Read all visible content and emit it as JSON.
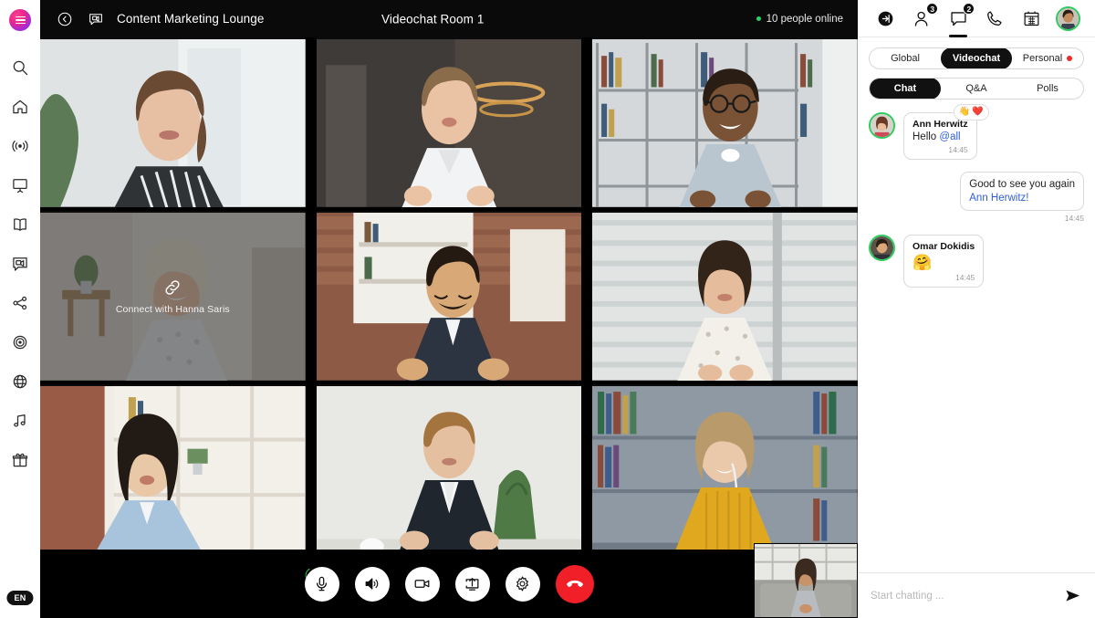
{
  "app": {
    "logo": "hamburger-logo",
    "language_badge": "EN"
  },
  "left_rail": {
    "items": [
      {
        "icon": "search-icon",
        "name": "search"
      },
      {
        "icon": "home-icon",
        "name": "home"
      },
      {
        "icon": "broadcast-icon",
        "name": "broadcast"
      },
      {
        "icon": "presentation-icon",
        "name": "presentation"
      },
      {
        "icon": "book-icon",
        "name": "library"
      },
      {
        "icon": "videochat-icon",
        "name": "videochat"
      },
      {
        "icon": "share-network-icon",
        "name": "network"
      },
      {
        "icon": "target-icon",
        "name": "goals"
      },
      {
        "icon": "globe-icon",
        "name": "globe"
      },
      {
        "icon": "music-icon",
        "name": "music"
      },
      {
        "icon": "gift-icon",
        "name": "gifts"
      }
    ]
  },
  "topbar": {
    "back_icon": "back-circle-icon",
    "room_icon": "videochat-icon",
    "breadcrumb": "Content Marketing Lounge",
    "title": "Videochat Room 1",
    "online_text": "10 people online",
    "online_color": "#25d366"
  },
  "grid": {
    "tiles": [
      {
        "name": "participant-1",
        "overlay": null
      },
      {
        "name": "participant-2",
        "overlay": null
      },
      {
        "name": "participant-3",
        "overlay": null
      },
      {
        "name": "participant-4",
        "overlay": {
          "icon": "link-icon",
          "label": "Connect with Hanna Saris"
        }
      },
      {
        "name": "participant-5",
        "overlay": null
      },
      {
        "name": "participant-6",
        "overlay": null
      },
      {
        "name": "participant-7",
        "overlay": null
      },
      {
        "name": "participant-8",
        "overlay": null
      },
      {
        "name": "participant-9",
        "overlay": null
      }
    ]
  },
  "controls": [
    {
      "name": "microphone",
      "icon": "mic-icon",
      "style": "light",
      "indicator": true
    },
    {
      "name": "speaker",
      "icon": "speaker-icon",
      "style": "light"
    },
    {
      "name": "camera",
      "icon": "camera-icon",
      "style": "light"
    },
    {
      "name": "screen-share",
      "icon": "screen-share-icon",
      "style": "light"
    },
    {
      "name": "settings",
      "icon": "gear-icon",
      "style": "light"
    },
    {
      "name": "hang-up",
      "icon": "phone-hangup-icon",
      "style": "danger",
      "color": "#f01f28"
    }
  ],
  "panel": {
    "top_icons": [
      {
        "name": "enter-room-icon",
        "badge": null,
        "active": false,
        "filled": true
      },
      {
        "name": "people-icon",
        "badge": "3",
        "active": false
      },
      {
        "name": "chat-icon",
        "badge": "2",
        "active": true
      },
      {
        "name": "phone-icon",
        "badge": null,
        "active": false
      },
      {
        "name": "calendar-icon",
        "badge": null,
        "active": false
      }
    ],
    "avatar": {
      "name": "user-avatar",
      "ring_color": "#2ecc5e"
    },
    "scope_tabs": [
      {
        "label": "Global",
        "active": false,
        "dot": false
      },
      {
        "label": "Videochat",
        "active": true,
        "dot": false
      },
      {
        "label": "Personal",
        "active": false,
        "dot": true
      }
    ],
    "content_tabs": [
      {
        "label": "Chat",
        "active": true
      },
      {
        "label": "Q&A",
        "active": false
      },
      {
        "label": "Polls",
        "active": false
      }
    ],
    "messages": [
      {
        "side": "in",
        "author": "Ann Herwitz",
        "text": "Hello ",
        "mention": "@all",
        "time": "14:45",
        "reactions": [
          "👋",
          "❤️"
        ],
        "emoji": null
      },
      {
        "side": "out",
        "author": null,
        "text": "Good to see you again ",
        "mention": "Ann Herwitz!",
        "time": "14:45",
        "reactions": [],
        "emoji": null
      },
      {
        "side": "in",
        "author": "Omar Dokidis",
        "text": "",
        "mention": null,
        "time": "14:45",
        "reactions": [],
        "emoji": "🤗"
      }
    ],
    "composer": {
      "placeholder": "Start chatting ...",
      "send_icon": "send-icon"
    }
  }
}
